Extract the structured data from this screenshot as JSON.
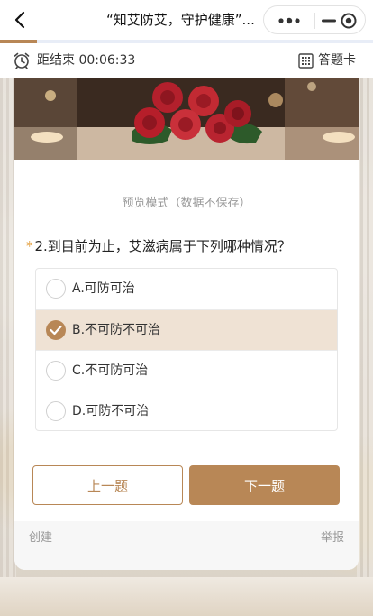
{
  "nav": {
    "title": "“知艾防艾，守护健康”...",
    "menu_icon": "more-dots-icon",
    "minimize_icon": "minimize-icon",
    "close_icon": "target-close-icon"
  },
  "progress": {
    "fraction": 0.1
  },
  "timer": {
    "label": "距结束 00:06:33",
    "icon": "alarm-clock-icon"
  },
  "answer_card": {
    "label": "答题卡",
    "icon": "grid-icon"
  },
  "survey": {
    "preview_note": "预览模式（数据不保存）",
    "question": {
      "required_mark": "*",
      "title": "2.到目前为止，艾滋病属于下列哪种情况？",
      "options": [
        {
          "label": "A.可防可治",
          "selected": false
        },
        {
          "label": "B.不可防不可治",
          "selected": true
        },
        {
          "label": "C.不可防可治",
          "selected": false
        },
        {
          "label": "D.可防不可治",
          "selected": false
        }
      ]
    },
    "prev_label": "上一题",
    "next_label": "下一题",
    "footer_left": "创建",
    "footer_right": "举报"
  },
  "colors": {
    "accent": "#b88756",
    "selected_bg": "#efe2d4",
    "required": "#e4a040"
  }
}
